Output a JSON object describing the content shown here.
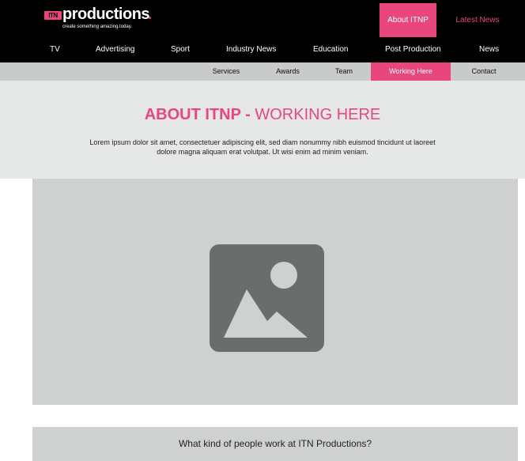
{
  "header": {
    "logo_mark": "ITN",
    "logo_word": "productions",
    "tagline": "create something amazing.today.",
    "about_label": "About ITNP",
    "latest_label": "Latest News"
  },
  "main_nav": [
    "TV",
    "Advertising",
    "Sport",
    "Industry News",
    "Education",
    "Post Production",
    "News"
  ],
  "sub_nav": {
    "items": [
      "Services",
      "Awards",
      "Team",
      "Working Here",
      "Contact"
    ],
    "active": "Working Here"
  },
  "hero": {
    "title_strong": "ABOUT ITNP - ",
    "title_light": "WORKING HERE",
    "body": "Lorem ipsum dolor sit amet, consectetuer adipiscing elit, sed diam nonummy nibh euismod tincidunt ut laoreet dolore magna aliquam erat volutpat. Ut wisi enim ad minim veniam."
  },
  "image_placeholder": {
    "icon": "image-icon"
  },
  "question": "What kind of people work at ITN Productions?",
  "colors": {
    "accent": "#e8467c",
    "topbar": "#000000",
    "subnav": "#c9caca",
    "hero_bg": "#e6e7e7",
    "placeholder_bg": "#cfd1d1",
    "icon": "#6b6d6d"
  }
}
